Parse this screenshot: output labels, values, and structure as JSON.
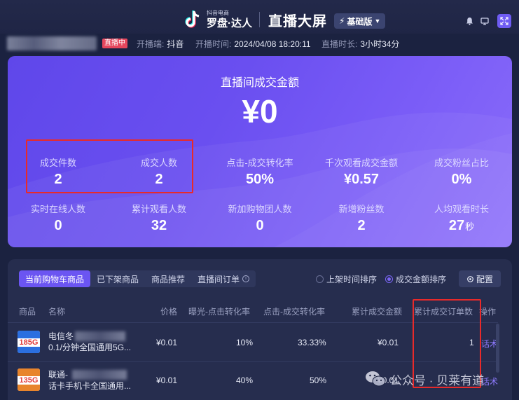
{
  "header": {
    "brand_small": "抖音电商",
    "brand_main": "罗盘·达人",
    "title": "直播大屏",
    "edition": "基础版"
  },
  "infobar": {
    "live_status": "直播中",
    "platform_label": "开播端:",
    "platform_value": "抖音",
    "start_label": "开播时间:",
    "start_value": "2024/04/08 18:20:11",
    "duration_label": "直播时长:",
    "duration_value": "3小时34分"
  },
  "main": {
    "title": "直播间成交金额",
    "amount": "¥0",
    "stats_row1": [
      {
        "label": "成交件数",
        "value": "2"
      },
      {
        "label": "成交人数",
        "value": "2"
      },
      {
        "label": "点击-成交转化率",
        "value": "50%"
      },
      {
        "label": "千次观看成交金额",
        "value": "¥0.57"
      },
      {
        "label": "成交粉丝占比",
        "value": "0%"
      }
    ],
    "stats_row2": [
      {
        "label": "实时在线人数",
        "value": "0"
      },
      {
        "label": "累计观看人数",
        "value": "32"
      },
      {
        "label": "新加购物团人数",
        "value": "0"
      },
      {
        "label": "新增粉丝数",
        "value": "2"
      },
      {
        "label": "人均观看时长",
        "value": "27",
        "unit": "秒"
      }
    ]
  },
  "panel": {
    "tabs": [
      "当前购物车商品",
      "已下架商品",
      "商品推荐",
      "直播间订单"
    ],
    "sort_options": [
      "上架时间排序",
      "成交金额排序"
    ],
    "config_label": "配置",
    "columns": [
      "商品",
      "名称",
      "价格",
      "曝光-点击转化率",
      "点击-成交转化率",
      "累计成交金额",
      "累计成交订单数",
      "操作"
    ],
    "rows": [
      {
        "thumb_number": "185G",
        "name_line1": "电信冬",
        "name_line2": "0.1/分钟全国通用5G...",
        "price": "¥0.01",
        "exposure_click": "10%",
        "click_deal": "33.33%",
        "total_amount": "¥0.01",
        "total_orders": "1",
        "operation": "话术"
      },
      {
        "thumb_number": "135G",
        "name_line1": "联通-",
        "name_line2": "话卡手机卡全国通用...",
        "price": "¥0.01",
        "exposure_click": "40%",
        "click_deal": "50%",
        "total_amount": "¥0.01",
        "total_orders": "",
        "operation": "话术"
      }
    ]
  },
  "watermark": "公众号 · 贝莱有道",
  "colors": {
    "accent": "#6b55f2",
    "live_red": "#e6465d",
    "annotation_red": "#e82a2a"
  }
}
